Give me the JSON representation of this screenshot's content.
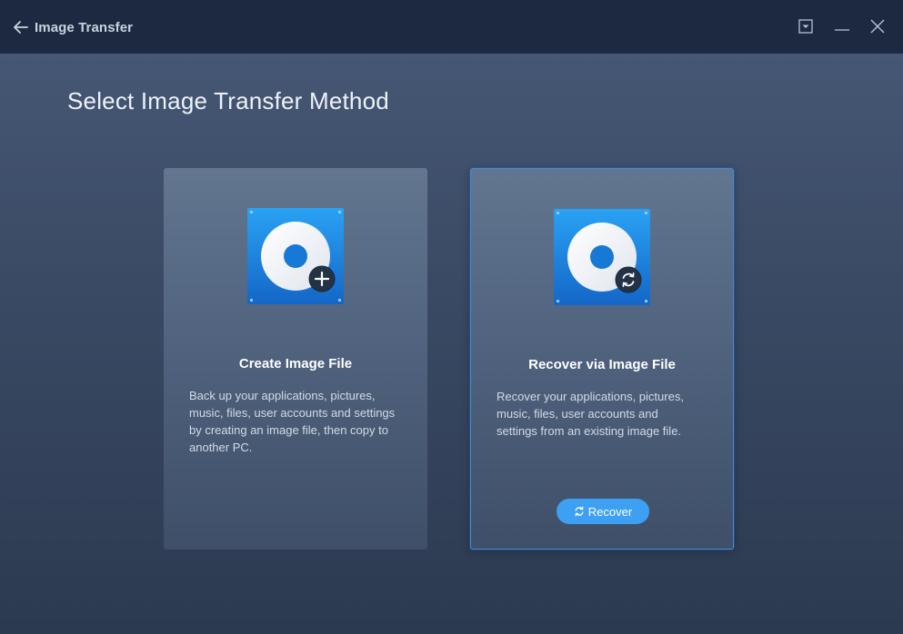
{
  "app": {
    "title": "Image Transfer"
  },
  "icons": {
    "back": "arrow-left-icon",
    "menu": "dropdown-menu-icon",
    "minimize": "minimize-icon",
    "close": "close-icon",
    "create_card": "disk-plus-icon",
    "recover_card": "disk-refresh-icon",
    "recover_button": "refresh-icon"
  },
  "heading": "Select Image Transfer Method",
  "cards": [
    {
      "title": "Create Image File",
      "description": "Back up your applications, pictures, music, files, user accounts and settings by creating an image file, then copy to another PC."
    },
    {
      "title": "Recover via Image File",
      "description": "Recover your applications, pictures, music, files, user accounts and settings from an existing image file.",
      "button_label": "Recover"
    }
  ],
  "colors": {
    "titlebar": "#1c2940",
    "accent": "#3ea0f2",
    "selected_border": "#3f8ad8"
  }
}
